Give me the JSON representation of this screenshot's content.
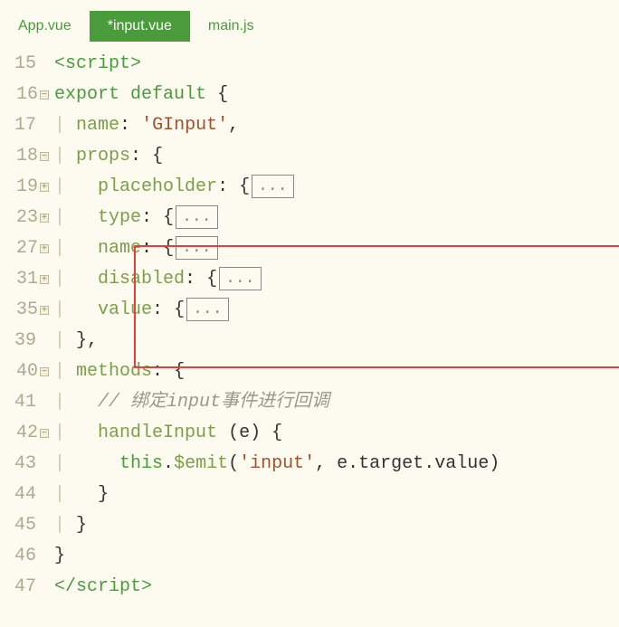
{
  "tabs": [
    {
      "label": "App.vue",
      "active": false
    },
    {
      "label": "*input.vue",
      "active": true
    },
    {
      "label": "main.js",
      "active": false
    }
  ],
  "lineNums": [
    "15",
    "16",
    "17",
    "18",
    "19",
    "23",
    "27",
    "31",
    "35",
    "39",
    "40",
    "41",
    "42",
    "43",
    "44",
    "45",
    "46",
    "47"
  ],
  "folds": {
    "1": "minus",
    "3": "minus",
    "4": "plus",
    "5": "plus",
    "6": "plus",
    "7": "plus",
    "8": "plus",
    "10": "minus",
    "12": "minus"
  },
  "t": {
    "scriptOpen": "<script>",
    "scriptClose": "</script>",
    "export": "export",
    "default": "default",
    "name": "name",
    "GInput": "'GInput'",
    "props": "props",
    "placeholder": "placeholder",
    "type": "type",
    "nameprop": "name",
    "disabled": "disabled",
    "value": "value",
    "methods": "methods",
    "comment": "// 绑定input事件进行回调",
    "handleInput": "handleInput",
    "this": "this",
    "emit": "$emit",
    "inputStr": "'input'",
    "e": "e",
    "target": "target",
    "valueProp": "value",
    "fold": "...",
    "brace_o": "{",
    "brace_c": "}",
    "paren_o": "(",
    "paren_c": ")",
    "colon": ":",
    "comma": ",",
    "dot": "."
  }
}
